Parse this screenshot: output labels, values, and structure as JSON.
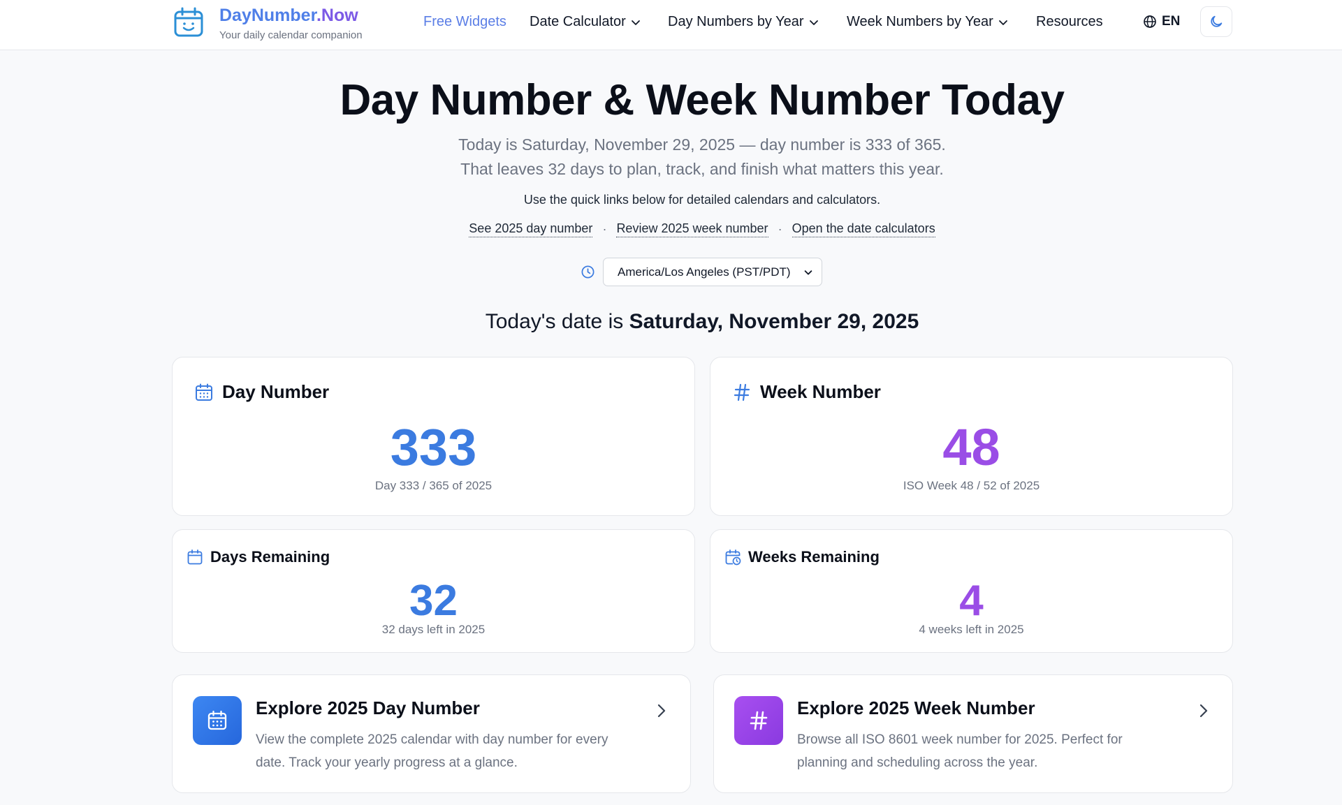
{
  "header": {
    "brand_main": "DayNumber",
    "brand_tld": ".Now",
    "tagline": "Your daily calendar companion",
    "nav": [
      {
        "label": "Free Widgets",
        "dropdown": false,
        "active": true
      },
      {
        "label": "Date Calculator",
        "dropdown": true
      },
      {
        "label": "Day Numbers by Year",
        "dropdown": true
      },
      {
        "label": "Week Numbers by Year",
        "dropdown": true
      },
      {
        "label": "Resources",
        "dropdown": false
      }
    ],
    "language": "EN",
    "theme_icon": "moon-icon"
  },
  "hero": {
    "title": "Day Number & Week Number Today",
    "line1": "Today is Saturday, November 29, 2025 — day number is 333 of 365.",
    "line2": "That leaves 32 days to plan, track, and finish what matters this year.",
    "quick_note": "Use the quick links below for detailed calendars and calculators.",
    "links": [
      "See 2025 day number",
      "Review 2025 week number",
      "Open the date calculators"
    ],
    "link_separator": "·",
    "timezone": "America/Los Angeles (PST/PDT)",
    "today_prefix": "Today's date is",
    "today_date": "Saturday, November 29, 2025"
  },
  "cards": {
    "day_number": {
      "title": "Day Number",
      "value": "333",
      "sub": "Day 333 / 365 of 2025"
    },
    "week_number": {
      "title": "Week Number",
      "value": "48",
      "sub": "ISO Week 48 / 52 of 2025"
    },
    "days_remaining": {
      "title": "Days Remaining",
      "value": "32",
      "sub": "32 days left in 2025"
    },
    "weeks_remaining": {
      "title": "Weeks Remaining",
      "value": "4",
      "sub": "4 weeks left in 2025"
    }
  },
  "explore": {
    "day": {
      "title": "Explore 2025 Day Number",
      "desc_line1": "View the complete 2025 calendar with day number for every",
      "desc_line2": "date. Track your yearly progress at a glance."
    },
    "week": {
      "title": "Explore 2025 Week Number",
      "desc_line1": "Browse all ISO 8601 week number for 2025. Perfect for",
      "desc_line2": "planning and scheduling across the year."
    }
  },
  "colors": {
    "accent_blue": "#3b7be0",
    "accent_purple": "#9a4de6",
    "brand_blue": "#4f7fe8",
    "brand_purple": "#7c5ae6"
  }
}
